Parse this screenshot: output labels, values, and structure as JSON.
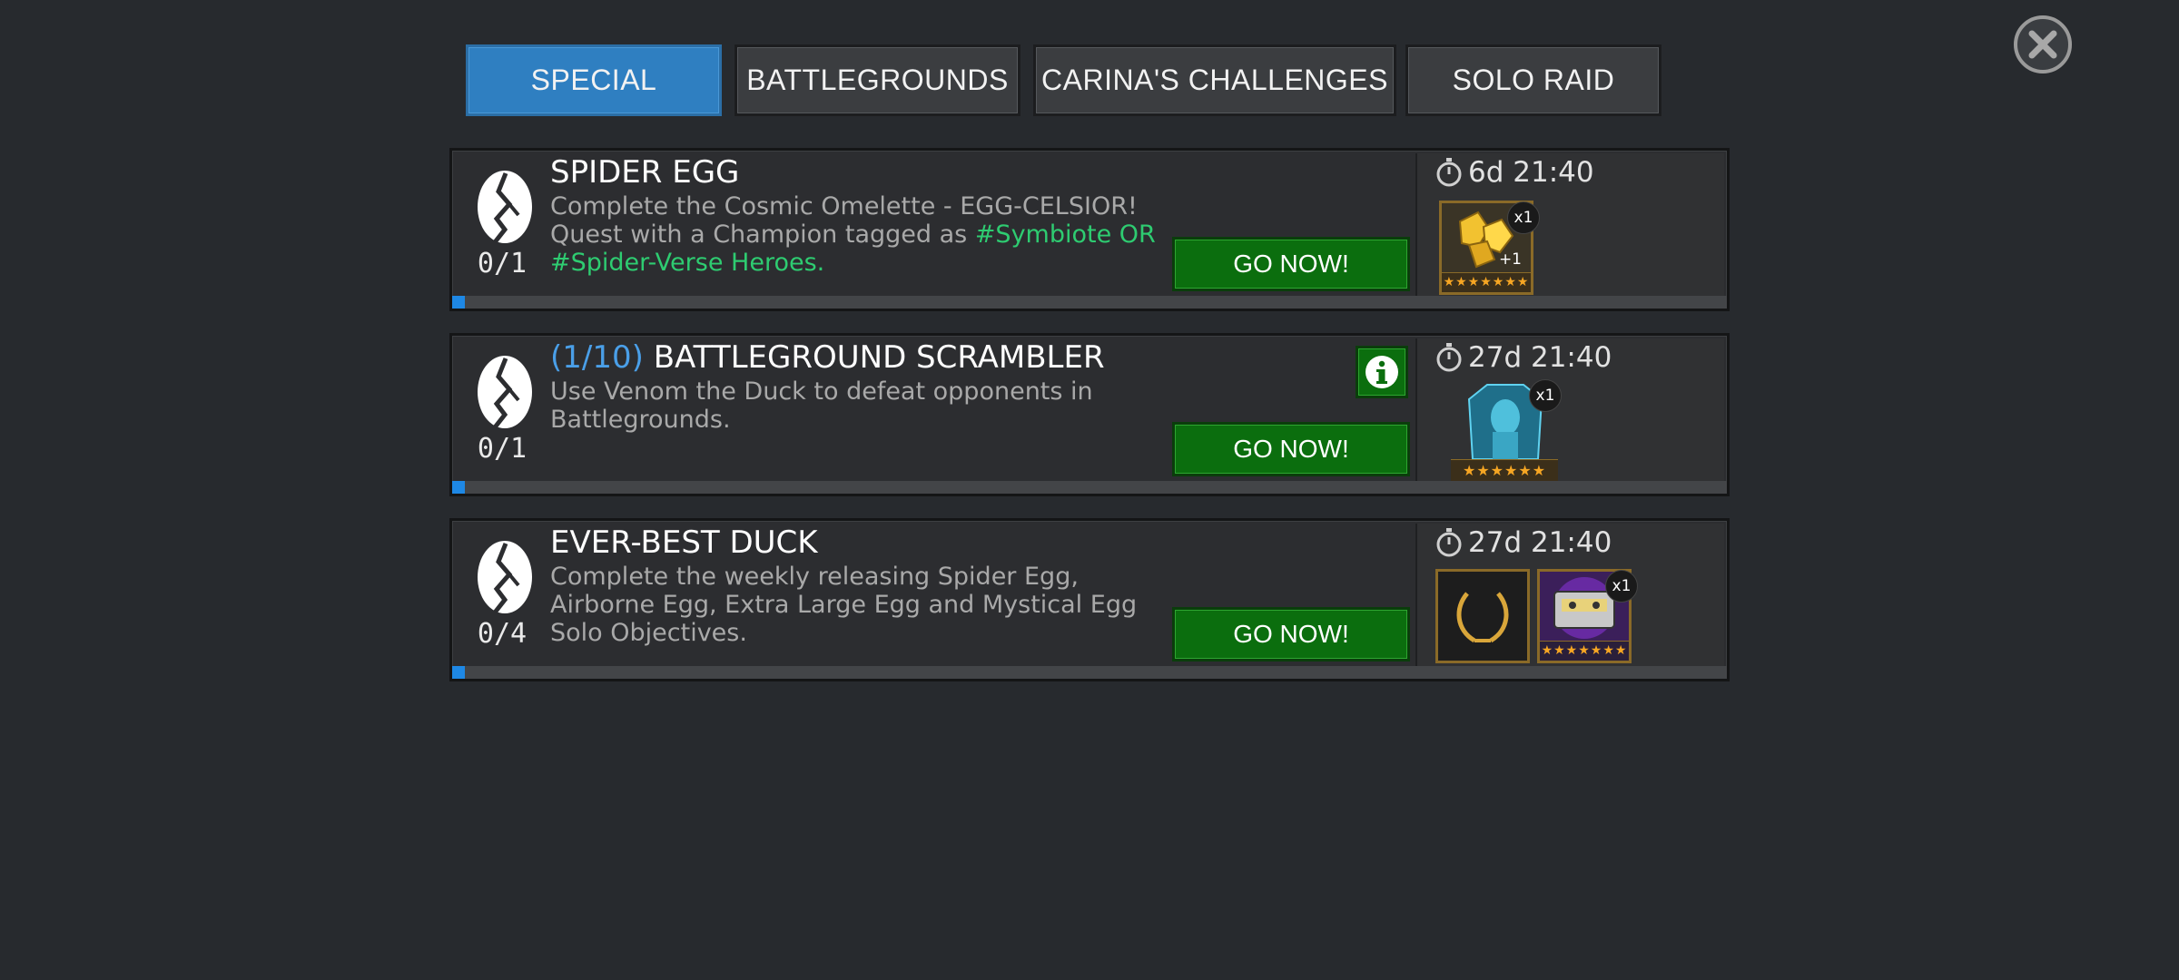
{
  "close": {
    "icon": "close-icon"
  },
  "tabs": [
    {
      "label": "SPECIAL",
      "active": true
    },
    {
      "label": "BATTLEGROUNDS",
      "active": false
    },
    {
      "label": "CARINA'S CHALLENGES",
      "active": false
    },
    {
      "label": "SOLO RAID",
      "active": false
    }
  ],
  "quests": [
    {
      "title": "SPIDER EGG",
      "title_prefix": "",
      "desc_plain": "Complete the Cosmic Omelette - EGG-CELSIOR! Quest with a Champion tagged as ",
      "desc_tag": "#Symbiote OR #Spider-Verse Heroes",
      "desc_end": ".",
      "count": "0/1",
      "progress": 0,
      "button": "GO NOW!",
      "timer": "6d 21:40",
      "rewards": [
        {
          "icon": "gold-shards-icon",
          "qty": "x1",
          "badge": "+1",
          "stars": "★★★★★★★"
        }
      ]
    },
    {
      "title": "BATTLEGROUND SCRAMBLER",
      "title_prefix": "(1/10)",
      "desc_plain": "Use Venom the Duck to defeat opponents in Battlegrounds.",
      "desc_tag": "",
      "desc_end": "",
      "count": "0/1",
      "progress": 0,
      "button": "GO NOW!",
      "info_icon": "info-icon",
      "timer": "27d 21:40",
      "rewards": [
        {
          "icon": "champion-crystal-icon",
          "qty": "x1",
          "stars": "★★★★★★"
        }
      ]
    },
    {
      "title": "EVER-BEST DUCK",
      "title_prefix": "",
      "desc_plain": "Complete the weekly releasing Spider Egg, Airborne Egg, Extra Large Egg and Mystical Egg Solo Objectives.",
      "desc_tag": "",
      "desc_end": "",
      "count": "0/4",
      "progress": 0,
      "button": "GO NOW!",
      "timer": "27d 21:40",
      "rewards": [
        {
          "icon": "laurel-wreath-icon"
        },
        {
          "icon": "cassette-tape-icon",
          "qty": "x1",
          "stars": "★★★★★★★"
        }
      ]
    }
  ],
  "colors": {
    "background": "#272a2e",
    "tab_active": "#2f7fc1",
    "go_button": "#0b6e0e",
    "tag_green": "#2ecc71",
    "prefix_blue": "#4a9fe8",
    "progress_blue": "#1e88e5"
  }
}
